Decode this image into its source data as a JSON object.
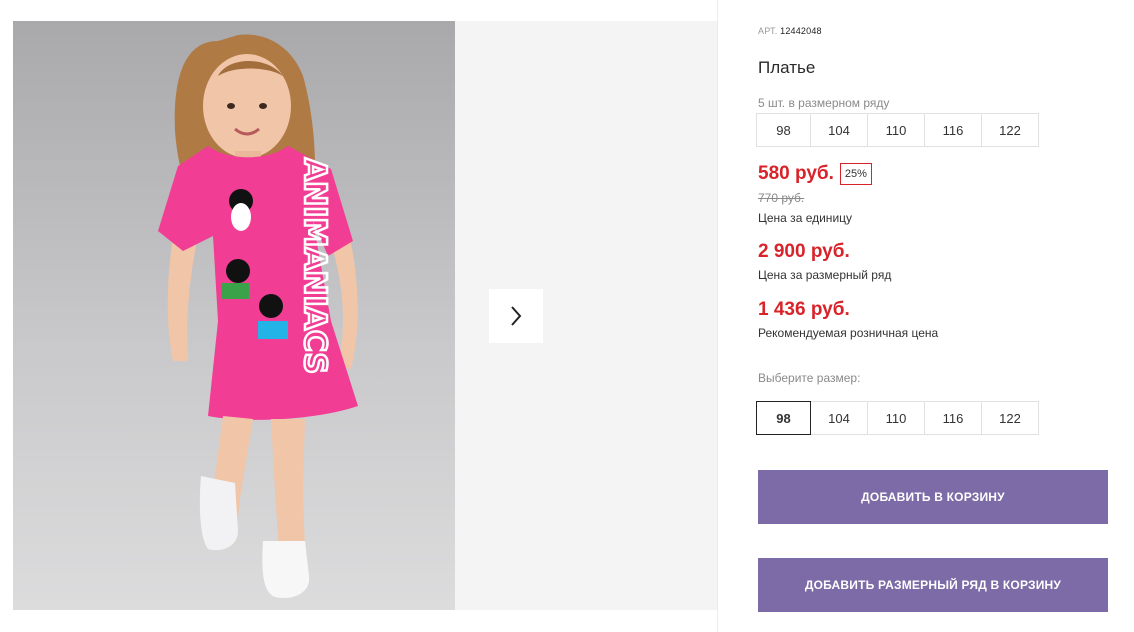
{
  "product": {
    "article_label": "АРТ.",
    "article_number": "12442048",
    "title": "Платье",
    "pack_note": "5 шт. в размерном ряду",
    "pack_sizes": [
      "98",
      "104",
      "110",
      "116",
      "122"
    ],
    "price_unit": "580 руб.",
    "discount": "25%",
    "old_price": "770 руб.",
    "price_unit_note": "Цена за единицу",
    "price_pack": "2 900 руб.",
    "price_pack_note": "Цена за размерный ряд",
    "price_retail": "1 436 руб.",
    "price_retail_note": "Рекомендуемая розничная цена",
    "choose_size_label": "Выберите размер:",
    "size_options": [
      "98",
      "104",
      "110",
      "116",
      "122"
    ],
    "selected_size": "98"
  },
  "photo": {
    "print_text": "ANIMANIACS"
  },
  "actions": {
    "add_to_cart": "Добавить в корзину",
    "add_pack_to_cart": "Добавить размерный ряд в корзину"
  },
  "colors": {
    "price_red": "#d8232a",
    "button_purple": "#7c6ba6",
    "dress_pink": "#f23d94"
  },
  "icons": {
    "next_arrow": "chevron-right-icon"
  }
}
